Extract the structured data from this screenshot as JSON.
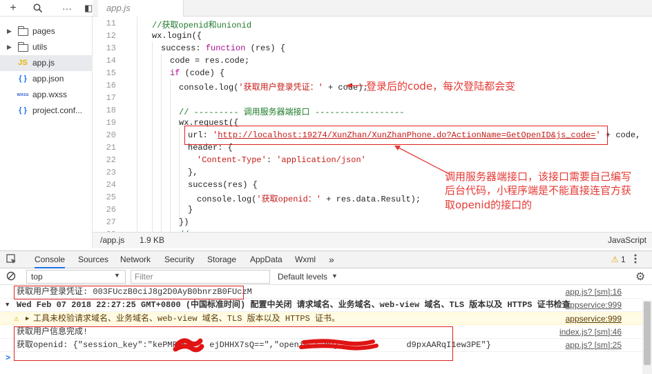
{
  "sidebar": {
    "items": [
      {
        "label": "pages",
        "type": "folder"
      },
      {
        "label": "utils",
        "type": "folder"
      },
      {
        "label": "app.js",
        "type": "js",
        "icon_text": "JS"
      },
      {
        "label": "app.json",
        "type": "json",
        "icon_text": "{ }"
      },
      {
        "label": "app.wxss",
        "type": "wxss",
        "icon_text": "wxss"
      },
      {
        "label": "project.conf...",
        "type": "json",
        "icon_text": "{ }"
      }
    ]
  },
  "editor": {
    "tab_label": "app.js",
    "line_numbers": [
      "11",
      "12",
      "13",
      "14",
      "15",
      "16",
      "17",
      "18",
      "19",
      "20",
      "21",
      "22",
      "23",
      "24",
      "25",
      "26",
      "27",
      "28"
    ],
    "lines": {
      "l11": "//获取openid和unionid",
      "l12": "wx.login({",
      "l13_a": "success: ",
      "l13_b": "function",
      "l13_c": " (res) {",
      "l14": "code = res.code;",
      "l15_a": "if",
      "l15_b": " (code) {",
      "l16_a": "console.log(",
      "l16_b": "'获取用户登录凭证：'",
      "l16_c": " + code);",
      "l18": "// --------- 调用服务器端接口 ------------------",
      "l19": "wx.request({",
      "l20_a": "url: ",
      "l20_b": "'",
      "l20_url": "http://localhost:19274/XunZhan/XunZhanPhone.do?ActionName=GetOpenID&js_code=",
      "l20_c": "'",
      "l20_d": " + code,",
      "l21": "header: {",
      "l22_a": "'Content-Type'",
      "l22_b": ": ",
      "l22_c": "'application/json'",
      "l23": "},",
      "l24": "success(res) {",
      "l25_a": "console.log(",
      "l25_b": "'获取openid：'",
      "l25_c": " + res.data.Result);",
      "l26": "}",
      "l27": "})",
      "l28": "//"
    }
  },
  "statusbar": {
    "file": "/app.js",
    "size": "1.9 KB",
    "language": "JavaScript"
  },
  "annotations": {
    "code_note": "登录后的code，每次登陆都会变",
    "server_note_1": "调用服务器端接口，该接口需要自己编写",
    "server_note_2": "后台代码，小程序端是不能直接连官方获",
    "server_note_3": "取openid的接口的"
  },
  "devtools": {
    "tabs": [
      "Console",
      "Sources",
      "Network",
      "Security",
      "Storage",
      "AppData",
      "Wxml"
    ],
    "more": "»",
    "warning_count": "1",
    "context": "top",
    "filter_placeholder": "Filter",
    "levels": "Default levels"
  },
  "console": {
    "rows": [
      {
        "msg": "获取用户登录凭证: 003FUczB0ciJ8g2D0AyB0bnrzB0FUczM",
        "src": "app.js? [sm]:16"
      },
      {
        "msg": "Wed Feb 07 2018 22:27:25 GMT+0800 (中国标准时间) 配置中关闭 请求域名、业务域名、web-view 域名、TLS 版本以及 HTTPS 证书检查",
        "src": "appservice:999"
      },
      {
        "msg": "工具未校验请求域名、业务域名、web-view 域名、TLS 版本以及 HTTPS 证书。",
        "src": "appservice:999"
      },
      {
        "msg": "获取用户信息完成!",
        "src": "index.js? [sm]:46"
      },
      {
        "msg_a": "获取openid: {\"session_key\":\"kePMPHG",
        "msg_b": "ejDHHX7sQ==\",\"openid\":\"oOj",
        "msg_c": "d9pxAARqI1ew3PE\"}",
        "src": "app.js? [sm]:25"
      }
    ],
    "prompt": ">"
  },
  "colors": {
    "annotation_red": "#e53935",
    "accent_blue": "#1a73e8",
    "warning_bg": "#fffbe5"
  }
}
